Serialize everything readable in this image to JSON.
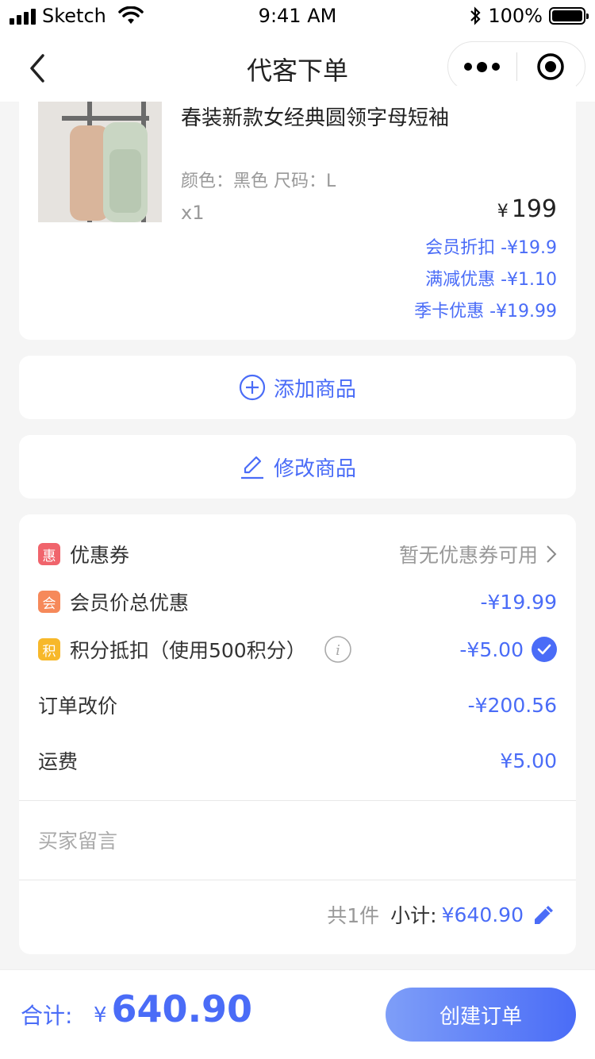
{
  "status_bar": {
    "carrier": "Sketch",
    "time": "9:41 AM",
    "battery": "100%"
  },
  "nav": {
    "title": "代客下单"
  },
  "product": {
    "name": "春装新款女经典圆领字母短袖",
    "spec": "颜色：黑色   尺码：L",
    "qty": "x1",
    "currency": "¥",
    "price": "199",
    "discounts": [
      "会员折扣 -¥19.9",
      "满减优惠 -¥1.10",
      "季卡优惠 -¥19.99"
    ]
  },
  "actions": {
    "add": "添加商品",
    "edit": "修改商品"
  },
  "order": {
    "coupon": {
      "badge": "惠",
      "label": "优惠券",
      "value": "暂无优惠券可用",
      "badge_color": "#f0646c"
    },
    "member": {
      "badge": "会",
      "label": "会员价总优惠",
      "value": "-¥19.99",
      "badge_color": "#f6895a"
    },
    "points": {
      "badge": "积",
      "label": "积分抵扣（使用500积分）",
      "value": "-¥5.00",
      "badge_color": "#f7b82a"
    },
    "reprice": {
      "label": "订单改价",
      "value": "-¥200.56"
    },
    "shipping": {
      "label": "运费",
      "value": "¥5.00"
    },
    "message_placeholder": "买家留言",
    "count": "共1件",
    "subtotal_label": "小计:",
    "subtotal_value": "¥640.90"
  },
  "bottom": {
    "total_label": "合计:",
    "currency": "¥",
    "total": "640.90",
    "button": "创建订单"
  },
  "colors": {
    "accent": "#4a6cf7"
  }
}
